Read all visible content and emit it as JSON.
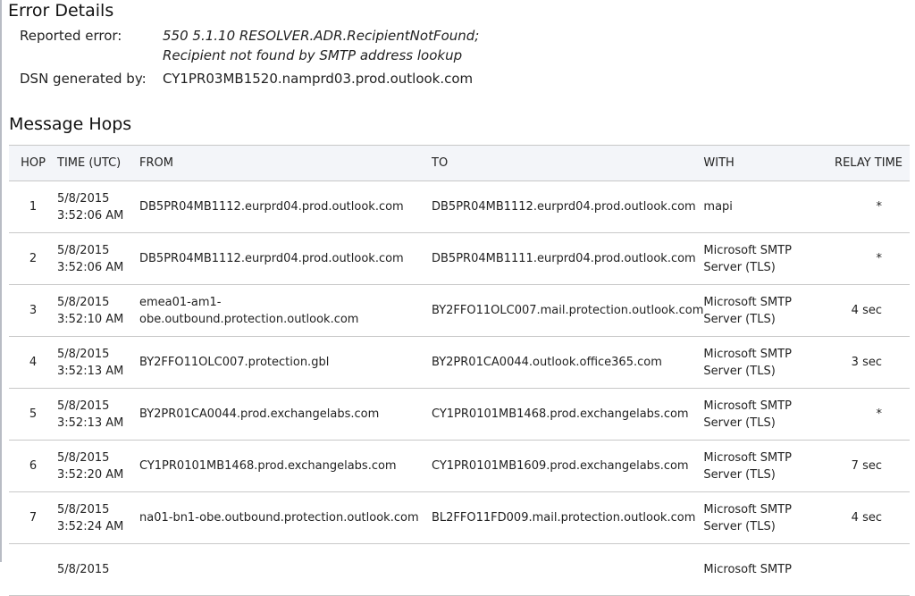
{
  "error_details": {
    "title": "Error Details",
    "reported_error_label": "Reported error:",
    "reported_error_line1": "550 5.1.10 RESOLVER.ADR.RecipientNotFound;",
    "reported_error_line2": "Recipient not found by SMTP address lookup",
    "dsn_label": "DSN generated by:",
    "dsn_value": "CY1PR03MB1520.namprd03.prod.outlook.com"
  },
  "message_hops": {
    "title": "Message Hops",
    "columns": [
      "HOP",
      "TIME (UTC)",
      "FROM",
      "TO",
      "WITH",
      "RELAY TIME"
    ],
    "rows": [
      {
        "hop": "1",
        "date": "5/8/2015",
        "time": "3:52:06 AM",
        "from": "DB5PR04MB1112.eurprd04.prod.outlook.com",
        "to": "DB5PR04MB1112.eurprd04.prod.outlook.com",
        "with1": "mapi",
        "with2": "",
        "relay": "*"
      },
      {
        "hop": "2",
        "date": "5/8/2015",
        "time": "3:52:06 AM",
        "from": "DB5PR04MB1112.eurprd04.prod.outlook.com",
        "to": "DB5PR04MB1111.eurprd04.prod.outlook.com",
        "with1": "Microsoft SMTP",
        "with2": "Server (TLS)",
        "relay": "*"
      },
      {
        "hop": "3",
        "date": "5/8/2015",
        "time": "3:52:10 AM",
        "from": "emea01-am1-obe.outbound.protection.outlook.com",
        "to": "BY2FFO11OLC007.mail.protection.outlook.com",
        "with1": "Microsoft SMTP",
        "with2": "Server (TLS)",
        "relay": "4 sec"
      },
      {
        "hop": "4",
        "date": "5/8/2015",
        "time": "3:52:13 AM",
        "from": "BY2FFO11OLC007.protection.gbl",
        "to": "BY2PR01CA0044.outlook.office365.com",
        "with1": "Microsoft SMTP",
        "with2": "Server (TLS)",
        "relay": "3 sec"
      },
      {
        "hop": "5",
        "date": "5/8/2015",
        "time": "3:52:13 AM",
        "from": "BY2PR01CA0044.prod.exchangelabs.com",
        "to": "CY1PR0101MB1468.prod.exchangelabs.com",
        "with1": "Microsoft SMTP",
        "with2": "Server (TLS)",
        "relay": "*"
      },
      {
        "hop": "6",
        "date": "5/8/2015",
        "time": "3:52:20 AM",
        "from": "CY1PR0101MB1468.prod.exchangelabs.com",
        "to": "CY1PR0101MB1609.prod.exchangelabs.com",
        "with1": "Microsoft SMTP",
        "with2": "Server (TLS)",
        "relay": "7 sec"
      },
      {
        "hop": "7",
        "date": "5/8/2015",
        "time": "3:52:24 AM",
        "from": "na01-bn1-obe.outbound.protection.outlook.com",
        "to": "BL2FFO11FD009.mail.protection.outlook.com",
        "with1": "Microsoft SMTP",
        "with2": "Server (TLS)",
        "relay": "4 sec"
      },
      {
        "hop": "",
        "date": "5/8/2015",
        "time": "",
        "from": "",
        "to": "",
        "with1": "Microsoft SMTP",
        "with2": "",
        "relay": ""
      }
    ]
  }
}
